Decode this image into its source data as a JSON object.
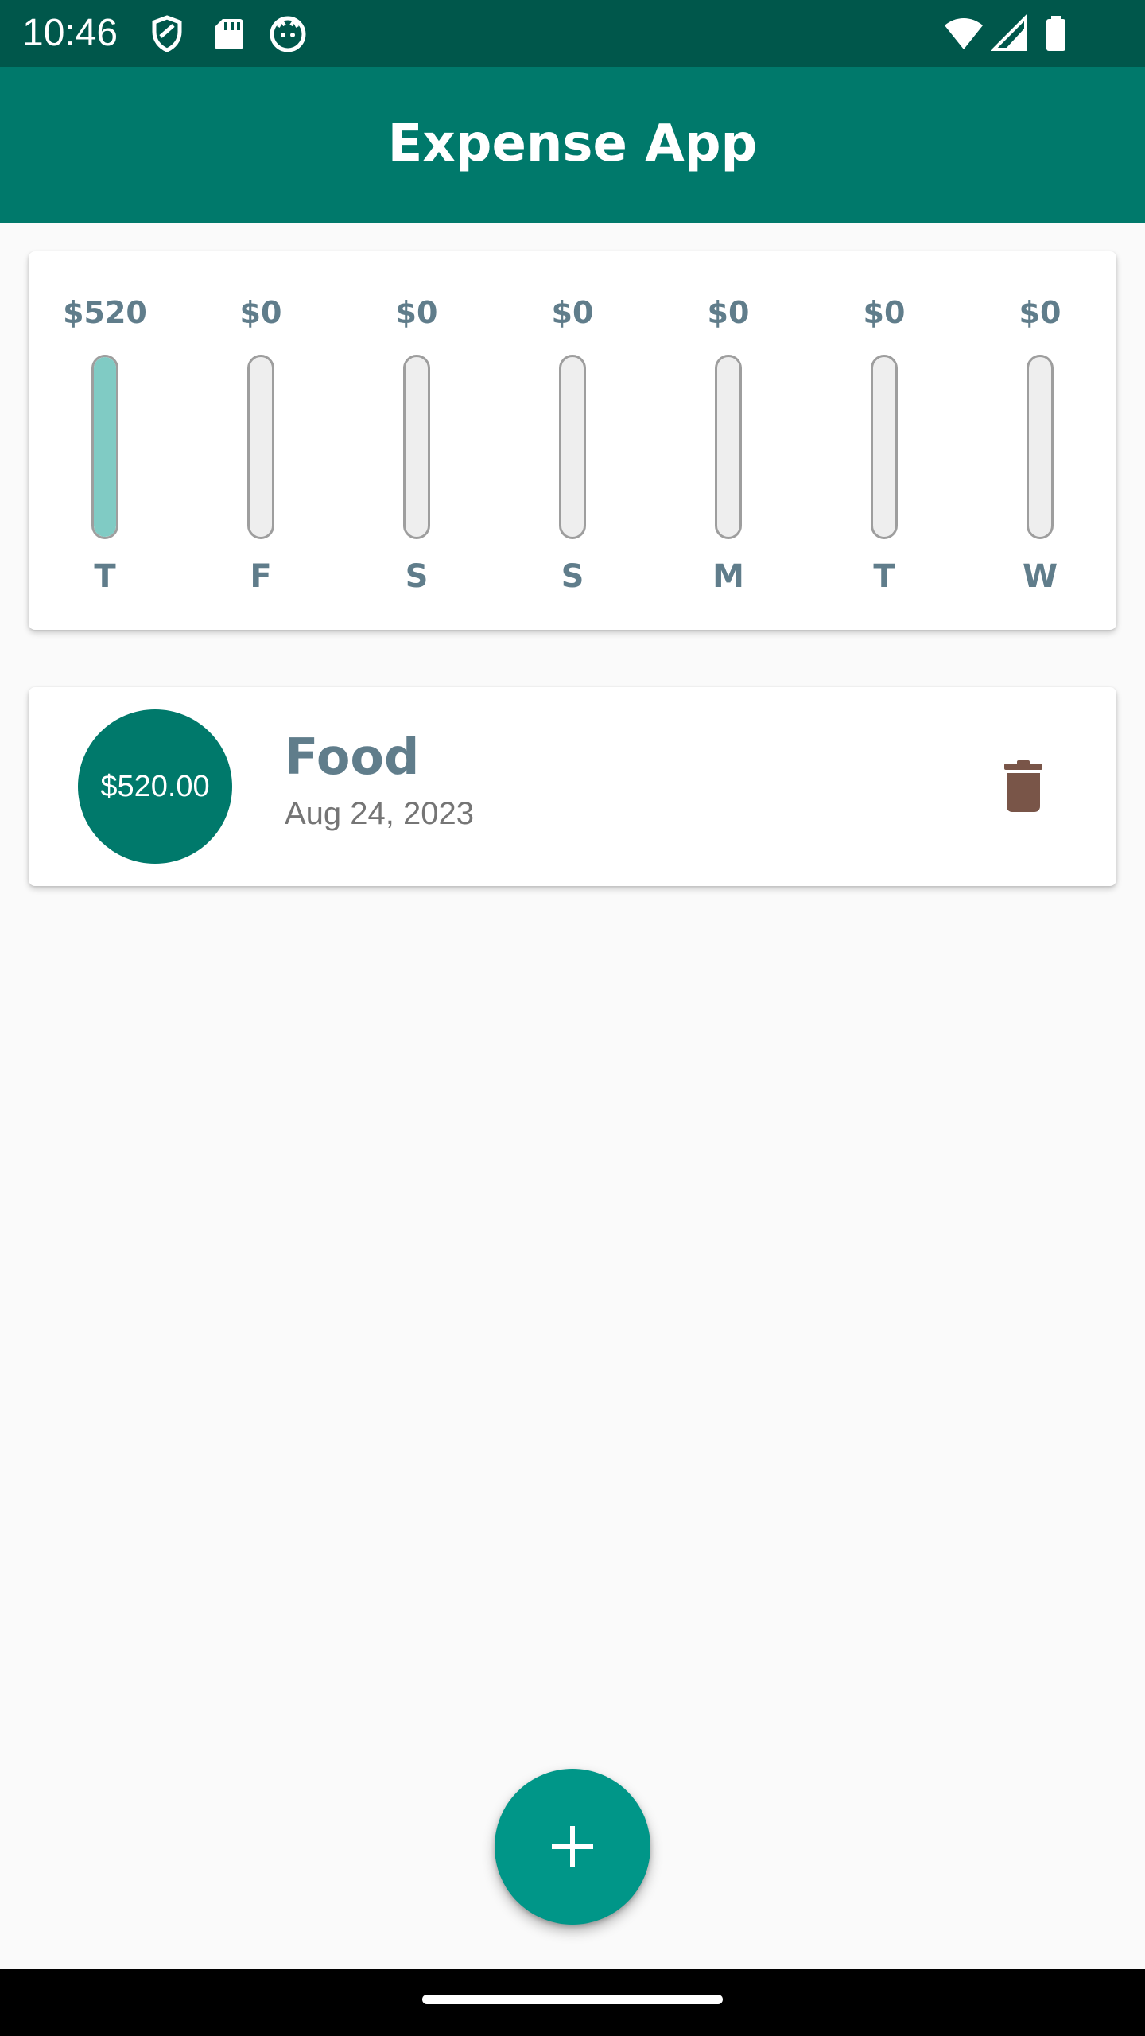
{
  "status_bar": {
    "time": "10:46",
    "left_icons": [
      "shield-icon",
      "sd-card-icon",
      "cat-face-icon"
    ],
    "right_icons": [
      "wifi-icon",
      "cellular-signal-icon",
      "battery-icon"
    ]
  },
  "app_bar": {
    "title": "Expense App",
    "color": "#00796b"
  },
  "chart": {
    "bars": [
      {
        "amount": "$520",
        "day": "T",
        "fill_fraction": 1.0
      },
      {
        "amount": "$0",
        "day": "F",
        "fill_fraction": 0.0
      },
      {
        "amount": "$0",
        "day": "S",
        "fill_fraction": 0.0
      },
      {
        "amount": "$0",
        "day": "S",
        "fill_fraction": 0.0
      },
      {
        "amount": "$0",
        "day": "M",
        "fill_fraction": 0.0
      },
      {
        "amount": "$0",
        "day": "T",
        "fill_fraction": 0.0
      },
      {
        "amount": "$0",
        "day": "W",
        "fill_fraction": 0.0
      }
    ],
    "fill_color": "#80cbc4",
    "track_color": "#eeeeee"
  },
  "transactions": [
    {
      "amount": "$520.00",
      "title": "Food",
      "date": "Aug 24, 2023",
      "delete_icon": "trash-icon"
    }
  ],
  "fab": {
    "icon": "plus-icon",
    "color": "#009688"
  },
  "colors": {
    "status_bar": "#00574b",
    "label_text": "#607d8b",
    "delete_icon": "#795548"
  }
}
